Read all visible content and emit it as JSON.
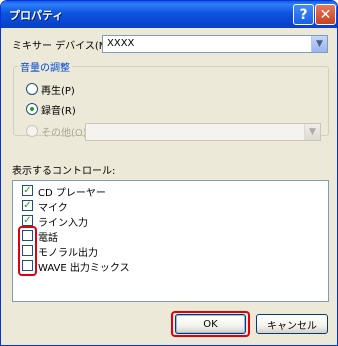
{
  "window": {
    "title": "プロパティ",
    "help_button": "?",
    "close_button": "✕"
  },
  "mixer": {
    "label": "ミキサー デバイス(M):",
    "value": "XXXX"
  },
  "volume_group": {
    "legend": "音量の調整",
    "options": [
      {
        "label": "再生(P)",
        "checked": false,
        "enabled": true
      },
      {
        "label": "録音(R)",
        "checked": true,
        "enabled": true
      },
      {
        "label": "その他(O)",
        "checked": false,
        "enabled": false
      }
    ],
    "other_select_value": ""
  },
  "controls": {
    "label": "表示するコントロール:",
    "items": [
      {
        "label": "CD プレーヤー",
        "checked": true
      },
      {
        "label": "マイク",
        "checked": true
      },
      {
        "label": "ライン入力",
        "checked": true
      },
      {
        "label": "電話",
        "checked": false
      },
      {
        "label": "モノラル出力",
        "checked": false
      },
      {
        "label": "WAVE 出力ミックス",
        "checked": false
      }
    ]
  },
  "buttons": {
    "ok": "OK",
    "cancel": "キャンセル"
  },
  "colors": {
    "highlight": "#e0000f",
    "group_legend": "#0046d5",
    "check_mark": "#21a121"
  }
}
